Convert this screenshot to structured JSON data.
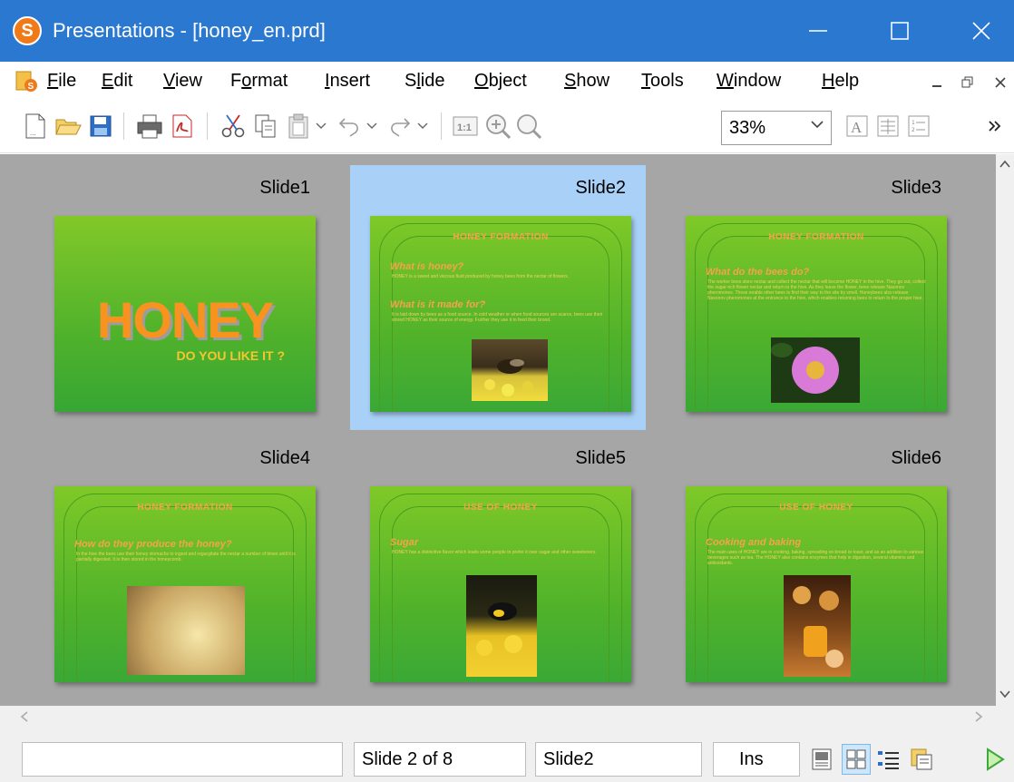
{
  "window": {
    "title": "Presentations - [honey_en.prd]",
    "logo_letter": "S"
  },
  "menu": {
    "items": [
      {
        "label": "File",
        "key": "F",
        "rest": "ile"
      },
      {
        "label": "Edit",
        "key": "E",
        "rest": "dit"
      },
      {
        "label": "View",
        "key": "V",
        "rest": "iew"
      },
      {
        "label": "Format",
        "key": "",
        "pre": "F",
        "mid": "o",
        "rest": "rmat"
      },
      {
        "label": "Insert",
        "key": "I",
        "rest": "nsert"
      },
      {
        "label": "Slide",
        "key": "",
        "pre": "S",
        "mid": "l",
        "rest": "ide"
      },
      {
        "label": "Object",
        "key": "O",
        "rest": "bject"
      },
      {
        "label": "Show",
        "key": "S",
        "rest": "how"
      },
      {
        "label": "Tools",
        "key": "T",
        "rest": "ools"
      },
      {
        "label": "Window",
        "key": "W",
        "rest": "indow"
      },
      {
        "label": "Help",
        "key": "H",
        "rest": "elp"
      }
    ]
  },
  "toolbar": {
    "zoom_value": "33%"
  },
  "slides": [
    {
      "label": "Slide1",
      "type": "title",
      "big_title": "HONEY",
      "subtitle": "DO YOU LIKE IT ?"
    },
    {
      "label": "Slide2",
      "type": "content",
      "title": "HONEY  FORMATION",
      "heading1": "What is honey?",
      "body1": "HONEY is a sweet and viscous fluid produced by honey bees from the nectar of flowers.",
      "heading2": "What is it made for?",
      "body2": "It is laid down by bees as a food source. In cold weather or when food sources are scarce, bees use their stored HONEY as their source of energy. Further they use it to feed their brood.",
      "picture": "bee-on-yellow-flowers"
    },
    {
      "label": "Slide3",
      "type": "content",
      "title": "HONEY  FORMATION",
      "heading1": "What do the bees do?",
      "body1": "The worker bees store nectar and collect the nectar that will become HONEY in the hive. They go out, collect the sugar-rich flower nectar and return to the hive. As they leave the flower, bees release Nasonov pheromones. These enable other bees to find their way to the site by smell. Honeybees also release Nasonov pheromones at the entrance to the hive, which enables returning bees to return to the proper hive.",
      "picture": "bee-on-purple-aster"
    },
    {
      "label": "Slide4",
      "type": "content",
      "title": "HONEY  FORMATION",
      "heading1": "How do they produce the honey?",
      "body1": "In the hive the bees use their honey stomachs to ingest and regurgitate the nectar a number of times until it is partially digested. It is then stored in the honeycomb.",
      "picture": "honeycomb"
    },
    {
      "label": "Slide5",
      "type": "content",
      "title": "USE OF HONEY",
      "heading1": "Sugar",
      "body1": "HONEY has a distinctive flavor which leads some people to prefer it over sugar and other sweeteners.",
      "picture": "bumblebee-on-yellow-flowers"
    },
    {
      "label": "Slide6",
      "type": "content",
      "title": "USE OF HONEY",
      "heading1": "Cooking and baking",
      "body1": "The main uses of HONEY are in cooking, baking, spreading on bread or toast, and as an addition to various beverages such as tea. The HONEY also contains enzymes that help in digestion, several vitamins and antioxidants.",
      "picture": "honey-jar-and-pastries"
    }
  ],
  "selected_slide": 2,
  "status": {
    "left_field": "",
    "slide_position": "Slide 2 of 8",
    "slide_name": "Slide2",
    "insert_mode": "Ins"
  }
}
